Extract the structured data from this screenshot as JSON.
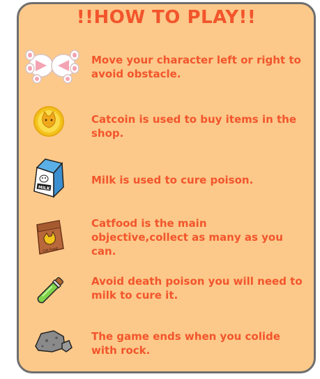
{
  "title": "!!HOW TO PLAY!!",
  "rules": [
    {
      "icon": "cat-paws-icon",
      "text": "Move your character left or right to avoid obstacle."
    },
    {
      "icon": "catcoin-icon",
      "text": "Catcoin is used to buy items in the shop."
    },
    {
      "icon": "milk-carton-icon",
      "text": "Milk is used to cure poison."
    },
    {
      "icon": "catfood-bag-icon",
      "text": "Catfood is the main objective,collect as many as you can."
    },
    {
      "icon": "poison-vial-icon",
      "text": "Avoid death poison you will need to milk to cure it."
    },
    {
      "icon": "rock-icon",
      "text": "The game ends when you colide with rock."
    }
  ],
  "milk_label": "MILK",
  "catfood_label": "Cat Food",
  "colors": {
    "panel": "#fcc98a",
    "border": "#6e6e6e",
    "text": "#f2552c"
  }
}
